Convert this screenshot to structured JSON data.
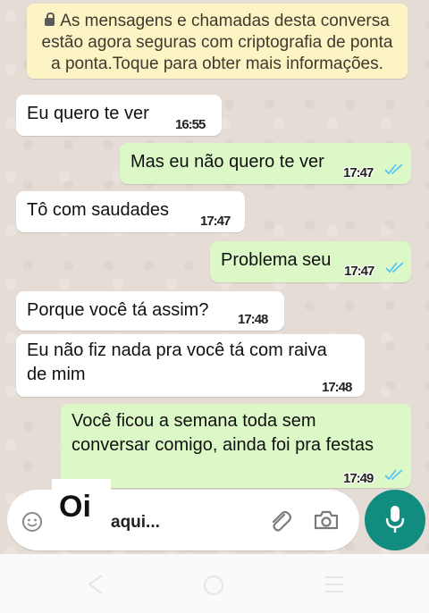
{
  "notice": {
    "text": "As mensagens e chamadas desta conversa estão agora seguras com criptografia de ponta a ponta.Toque para obter mais informações."
  },
  "messages": [
    {
      "dir": "in",
      "text": "Eu quero te ver",
      "time": "16:55",
      "ticks": false
    },
    {
      "dir": "out",
      "text": "Mas eu não quero te ver",
      "time": "17:47",
      "ticks": true
    },
    {
      "dir": "in",
      "text": "Tô com saudades",
      "time": "17:47",
      "ticks": false
    },
    {
      "dir": "out",
      "text": "Problema seu",
      "time": "17:47",
      "ticks": true
    },
    {
      "dir": "in",
      "text": "Porque você tá assim?",
      "time": "17:48",
      "ticks": false
    },
    {
      "dir": "in",
      "line1": "Eu não fiz nada pra você tá com raiva",
      "line2": "de mim",
      "time": "17:48",
      "ticks": false
    },
    {
      "dir": "out",
      "line1": "Você ficou a semana toda sem",
      "line2": "conversar comigo, ainda foi pra festas",
      "time": "17:49",
      "ticks": true
    }
  ],
  "overlay": {
    "oi": "Oi",
    "aqui": "aqui..."
  },
  "icons": {
    "emoji": "emoji-icon",
    "attach": "paperclip-icon",
    "camera": "camera-icon",
    "mic": "microphone-icon",
    "back": "back-icon",
    "home": "home-icon",
    "menu": "menu-icon"
  },
  "colors": {
    "incoming": "#ffffff",
    "outgoing": "#dcf8c6",
    "notice": "#fcf4c4",
    "accent": "#128c7e",
    "tick": "#4fc3f7"
  }
}
